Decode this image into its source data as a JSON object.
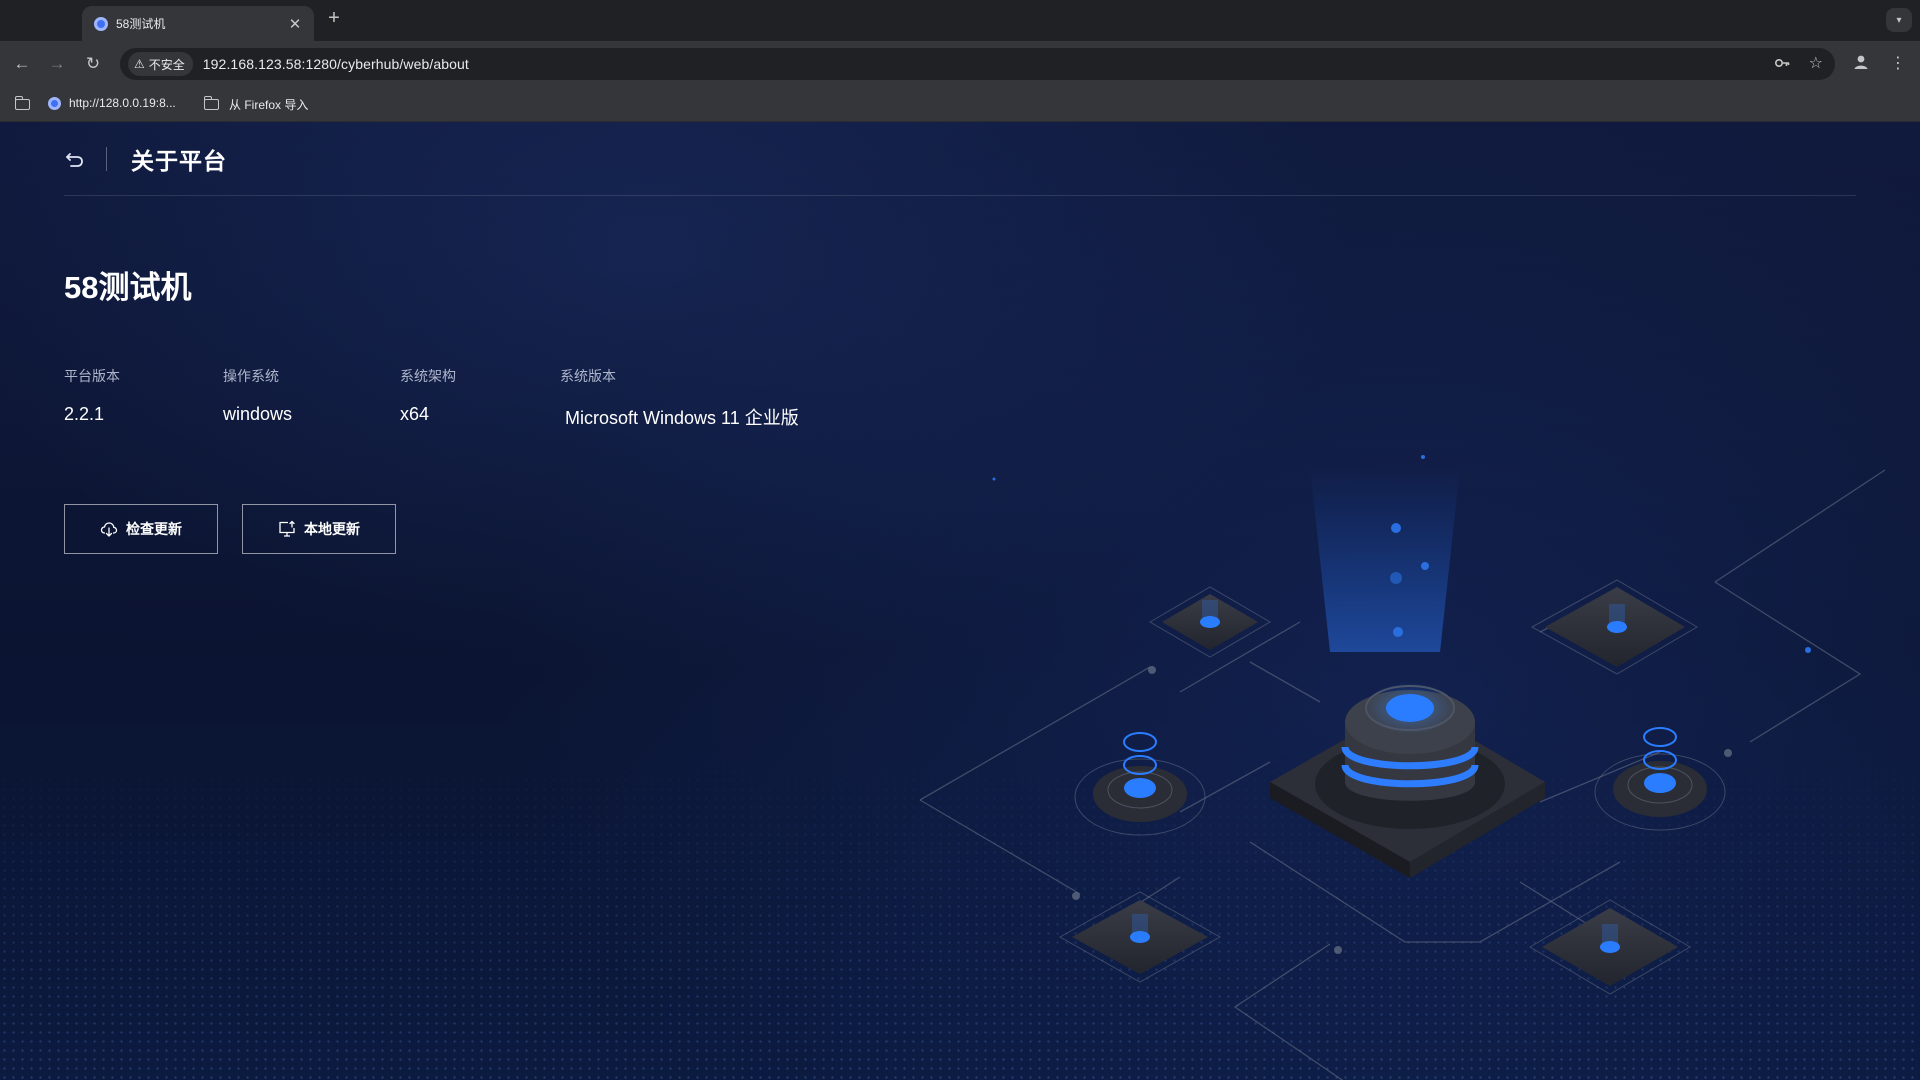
{
  "browser": {
    "tab_title": "58测试机",
    "security_label": "不安全",
    "url": "192.168.123.58:1280/cyberhub/web/about",
    "bookmarks": [
      {
        "label": "http://128.0.0.19:8..."
      },
      {
        "label": "从 Firefox 导入"
      }
    ]
  },
  "header": {
    "title": "关于平台"
  },
  "device": {
    "name": "58测试机"
  },
  "info": [
    {
      "label": "平台版本",
      "value": "2.2.1"
    },
    {
      "label": "操作系统",
      "value": "windows"
    },
    {
      "label": "系统架构",
      "value": "x64"
    },
    {
      "label": "系统版本",
      "value": "Microsoft Windows 11 企业版"
    }
  ],
  "actions": {
    "check_update": "检查更新",
    "local_update": "本地更新"
  },
  "colors": {
    "accent": "#1e6bf0",
    "page_bg": "#0c1430"
  }
}
